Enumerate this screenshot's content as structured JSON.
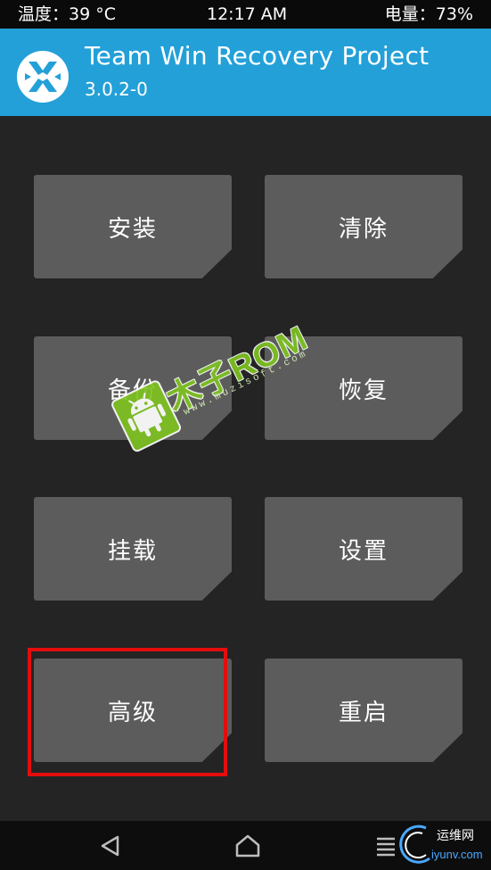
{
  "status_bar": {
    "temperature": "温度：39 °C",
    "time": "12:17 AM",
    "battery": "电量：73%"
  },
  "header": {
    "title": "Team Win Recovery Project",
    "version": "3.0.2-0",
    "logo_icon": "twrp-logo-icon"
  },
  "menu": {
    "install": "安装",
    "wipe": "清除",
    "backup": "备份",
    "restore": "恢复",
    "mount": "挂载",
    "settings": "设置",
    "advanced": "高级",
    "reboot": "重启"
  },
  "navbar": {
    "back_icon": "back-icon",
    "home_icon": "home-icon",
    "menu_icon": "menu-icon"
  },
  "watermark": {
    "text": "木子ROM",
    "url": "www.muzisoft.com"
  },
  "corner_watermark": {
    "top": "运维网",
    "bottom": "iyunv.com"
  },
  "colors": {
    "header_bg": "#23a0d8",
    "tile_bg": "#5c5c5c",
    "background": "#242424",
    "highlight": "#e30d0d",
    "watermark_green": "#7ec321"
  }
}
